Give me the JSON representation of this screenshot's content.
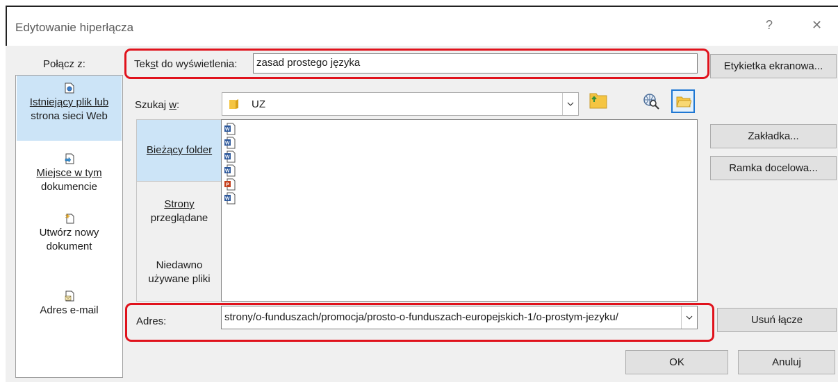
{
  "dialog": {
    "title": "Edytowanie hiperłącza",
    "help_label": "?",
    "close_label": "✕"
  },
  "link_to": {
    "label": "Połącz z:",
    "items": [
      {
        "label_1": "Istniejący plik lub",
        "label_2": "strona sieci Web",
        "icon": "web-page-icon"
      },
      {
        "label_1": "Miejsce w tym",
        "label_2": "dokumencie",
        "icon": "place-in-document-icon"
      },
      {
        "label_1": "Utwórz nowy",
        "label_2": "dokument",
        "icon": "new-document-icon"
      },
      {
        "label_1": "Adres e-mail",
        "label_2": "",
        "icon": "email-address-icon"
      }
    ]
  },
  "display_text": {
    "label_pre": "Tek",
    "label_hot": "s",
    "label_post": "t do wyświetlenia:",
    "value": "zasad prostego języka"
  },
  "screentip_button": "Etykietka ekranowa...",
  "look_in": {
    "label_pre": "Szukaj ",
    "label_hot": "w",
    "label_post": ":",
    "value": "UZ"
  },
  "sections": [
    {
      "label_1": "Bieżący folder",
      "label_2": ""
    },
    {
      "label_1": "Strony",
      "label_2": "przeglądane"
    },
    {
      "label_1": "Niedawno",
      "label_2": "używane pliki"
    }
  ],
  "files": [
    {
      "type": "word"
    },
    {
      "type": "word"
    },
    {
      "type": "word"
    },
    {
      "type": "word"
    },
    {
      "type": "powerpoint"
    },
    {
      "type": "word"
    }
  ],
  "right_buttons": {
    "bookmark": "Zakładka...",
    "target_frame": "Ramka docelowa...",
    "remove_link": "Usuń łącze"
  },
  "address": {
    "label": "Adres:",
    "value": "strony/o-funduszach/promocja/prosto-o-funduszach-europejskich-1/o-prostym-jezyku/"
  },
  "footer": {
    "ok": "OK",
    "cancel": "Anuluj"
  },
  "colors": {
    "highlight_box": "#e0121c",
    "selection": "#cce4f7"
  }
}
